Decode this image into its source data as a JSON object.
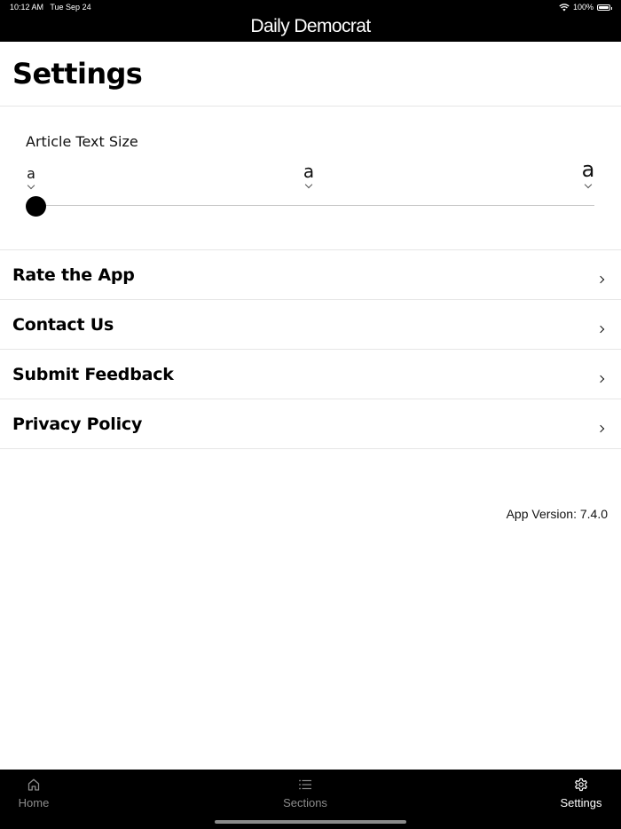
{
  "status_bar": {
    "time": "10:12 AM",
    "date": "Tue Sep 24",
    "battery": "100%"
  },
  "header": {
    "brand": "Daily Democrat"
  },
  "page": {
    "title": "Settings"
  },
  "text_size": {
    "label": "Article Text Size",
    "ticks": [
      "a",
      "a",
      "a"
    ],
    "selected_level": 0,
    "levels": 3
  },
  "menu": {
    "items": [
      {
        "label": "Rate the App"
      },
      {
        "label": "Contact Us"
      },
      {
        "label": "Submit Feedback"
      },
      {
        "label": "Privacy Policy"
      }
    ]
  },
  "app_version": "App Version: 7.4.0",
  "tabbar": {
    "tabs": [
      {
        "label": "Home",
        "icon": "home-icon",
        "active": false
      },
      {
        "label": "Sections",
        "icon": "list-icon",
        "active": false
      },
      {
        "label": "Settings",
        "icon": "gear-icon",
        "active": true
      }
    ]
  },
  "colors": {
    "bar": "#000000",
    "active_tab": "#ffffff",
    "inactive_tab": "#8c8c8c"
  }
}
